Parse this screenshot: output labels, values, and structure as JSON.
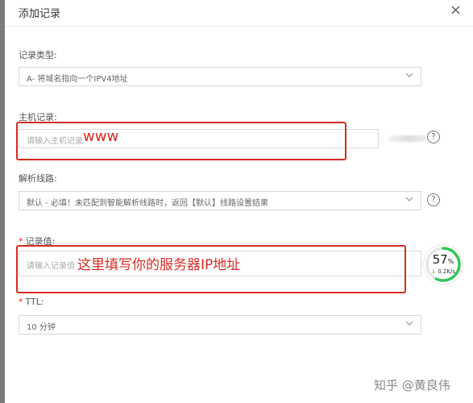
{
  "dialog": {
    "title": "添加记录",
    "close_symbol": "×"
  },
  "record_type": {
    "label": "记录类型:",
    "value": "A- 将域名指向一个IPV4地址"
  },
  "host_record": {
    "label": "主机记录:",
    "placeholder": "请输入主机记录",
    "annotation": "www",
    "help": "?"
  },
  "line": {
    "label": "解析线路:",
    "value": "默认 - 必填！未匹配到智能解析线路时，返回【默认】线路设置结果",
    "help": "?"
  },
  "record_value": {
    "required_mark": "*",
    "label": "记录值:",
    "placeholder": "请输入记录值",
    "annotation": "这里填写你的服务器IP地址"
  },
  "ttl": {
    "required_mark": "*",
    "label": "TTL:",
    "value": "10 分钟"
  },
  "speed_widget": {
    "percent": "57",
    "percent_unit": "%",
    "arrow": "↓",
    "rate": "0.2K/s",
    "ring_fill": 0.57
  },
  "watermark": "知乎 @黄良伟",
  "colors": {
    "annotation_red": "#d62b23",
    "ring_green": "#34c759"
  }
}
